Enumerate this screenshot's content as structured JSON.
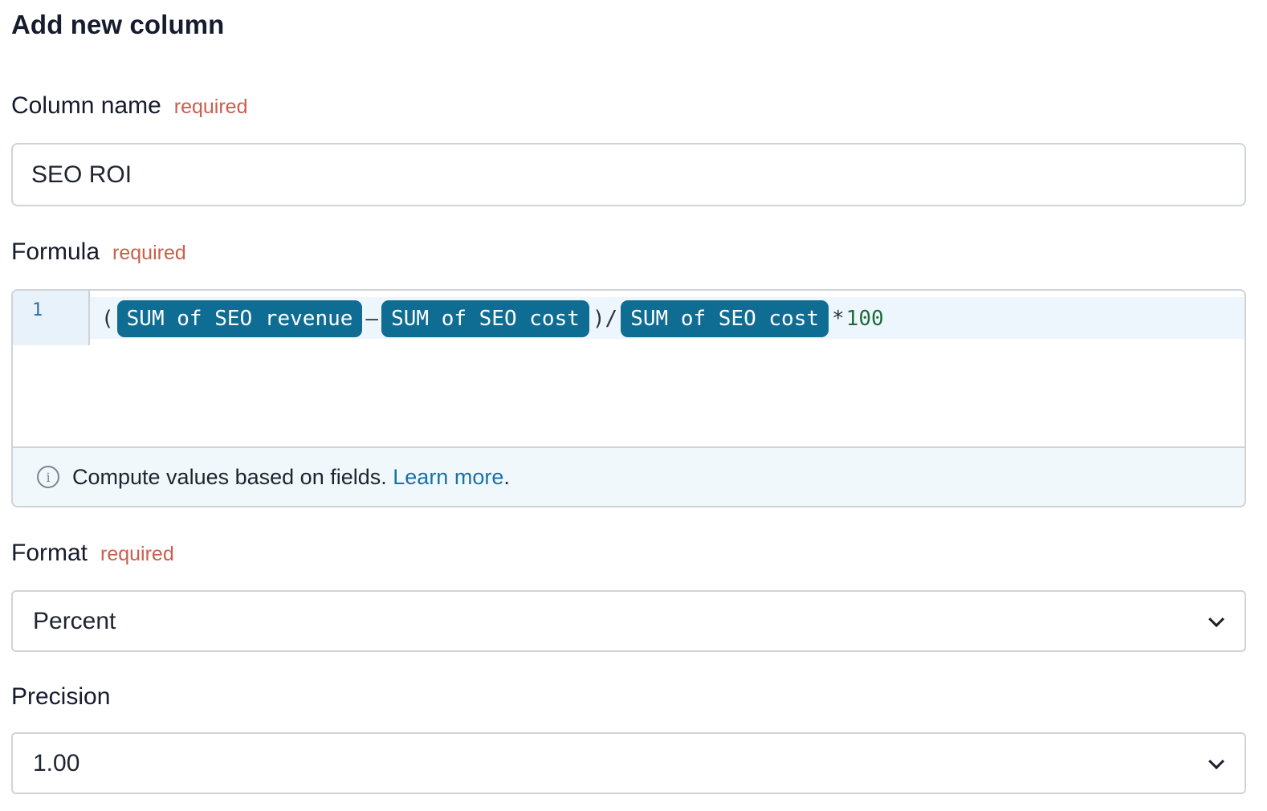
{
  "title": "Add new column",
  "column_name": {
    "label": "Column name",
    "required": "required",
    "value": "SEO ROI"
  },
  "formula": {
    "label": "Formula",
    "required": "required",
    "line_number": "1",
    "tokens": {
      "open_paren": "(",
      "field1": "SUM of SEO revenue",
      "minus": "–",
      "field2": "SUM of SEO cost",
      "close_div": ")/",
      "field3": "SUM of SEO cost",
      "mult": "*",
      "number": "100"
    },
    "hint_text": "Compute values based on fields.",
    "hint_link": "Learn more",
    "hint_period": ".",
    "info_icon": "info-icon"
  },
  "format": {
    "label": "Format",
    "required": "required",
    "selected": "Percent"
  },
  "precision": {
    "label": "Precision",
    "selected": "1.00"
  },
  "colors": {
    "chip": "#0f6d94",
    "required": "#c8604c",
    "link": "#1772a6"
  }
}
